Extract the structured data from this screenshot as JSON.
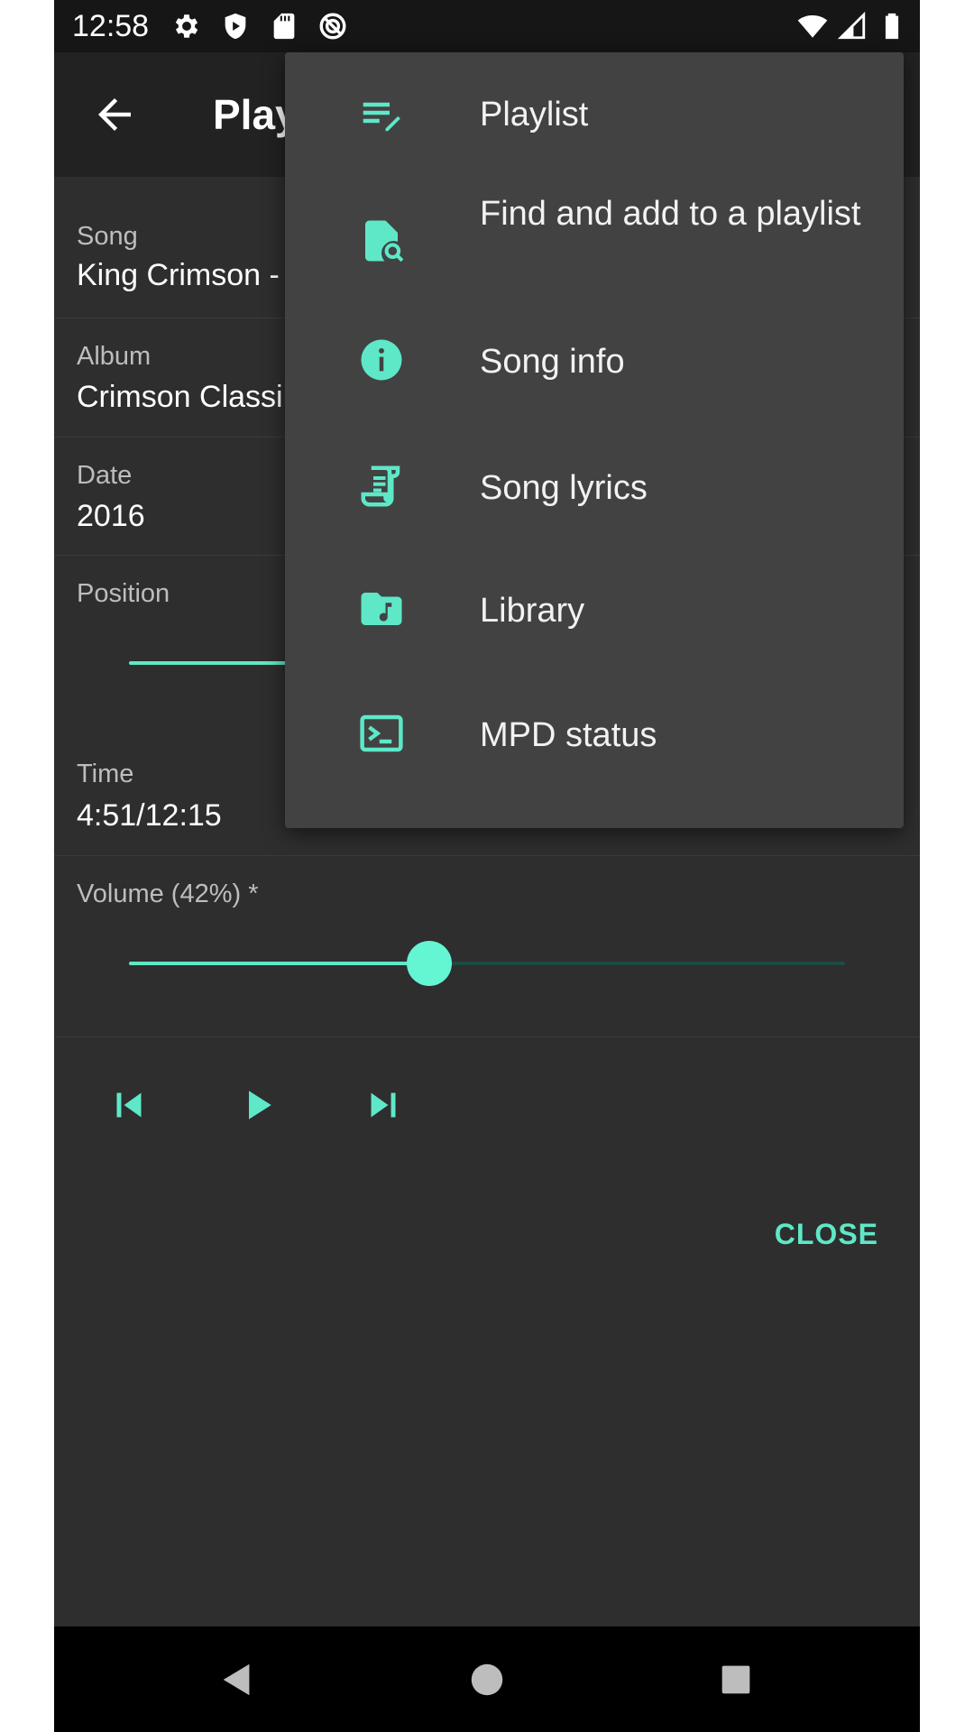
{
  "status_bar": {
    "time": "12:58",
    "left_icons": [
      "settings-icon",
      "shield-icon",
      "sd-card-icon",
      "sync-disabled-icon"
    ],
    "right_icons": [
      "wifi-icon",
      "cell-signal-icon",
      "battery-icon"
    ]
  },
  "app_bar": {
    "title": "Play"
  },
  "song": {
    "label": "Song",
    "value": "King Crimson -"
  },
  "album": {
    "label": "Album",
    "value": "Crimson Classi"
  },
  "date": {
    "label": "Date",
    "value": "2016"
  },
  "position": {
    "label": "Position",
    "fraction": 0.4
  },
  "time": {
    "label": "Time",
    "value": "4:51/12:15"
  },
  "volume": {
    "label": "Volume (42%) *",
    "percent": 42
  },
  "transport": {
    "buttons": [
      "skip-previous-icon",
      "play-icon",
      "skip-next-icon"
    ]
  },
  "close_label": "CLOSE",
  "menu": {
    "items": [
      {
        "label": "Playlist",
        "icon": "playlist-edit-icon"
      },
      {
        "label": "Find and add to a playlist",
        "icon": "file-search-icon"
      },
      {
        "label": "Song info",
        "icon": "info-icon"
      },
      {
        "label": "Song lyrics",
        "icon": "lyrics-icon"
      },
      {
        "label": "Library",
        "icon": "music-folder-icon"
      },
      {
        "label": "MPD status",
        "icon": "terminal-icon"
      }
    ]
  },
  "colors": {
    "accent": "#5ee8c8",
    "background": "#2e2e2e",
    "menu_background": "#424242"
  },
  "nav_bar": {
    "buttons": [
      "back-triangle-icon",
      "home-circle-icon",
      "recents-square-icon"
    ]
  }
}
